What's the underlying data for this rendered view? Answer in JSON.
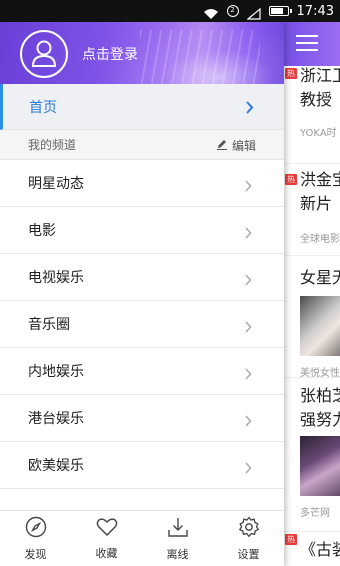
{
  "status_bar": {
    "time": "17:43",
    "sim_label": "2"
  },
  "drawer": {
    "login_label": "点击登录",
    "home_label": "首页",
    "section_title": "我的频道",
    "edit_label": "编辑",
    "channels": [
      {
        "label": "明星动态"
      },
      {
        "label": "电影"
      },
      {
        "label": "电视娱乐"
      },
      {
        "label": "音乐圈"
      },
      {
        "label": "内地娱乐"
      },
      {
        "label": "港台娱乐"
      },
      {
        "label": "欧美娱乐"
      }
    ],
    "bottom_nav": [
      {
        "label": "发现",
        "icon": "compass-icon"
      },
      {
        "label": "收藏",
        "icon": "heart-icon"
      },
      {
        "label": "离线",
        "icon": "download-icon"
      },
      {
        "label": "设置",
        "icon": "gear-icon"
      }
    ]
  },
  "feed": {
    "hot_badge": "热",
    "items": [
      {
        "title_line1": "浙江卫",
        "title_line2": "教授",
        "source": "YOKA时"
      },
      {
        "title_line1": "洪金宝",
        "title_line2": "新片",
        "source": "全球电影"
      },
      {
        "title_line1": "女星无",
        "source": "美悦女性"
      },
      {
        "title_line1": "张柏芝",
        "title_line2": "强努力",
        "source": "多芒网"
      },
      {
        "title_line1": "《古装"
      }
    ]
  },
  "colors": {
    "accent": "#2a7bd6",
    "header_purple": "#7750e6",
    "hot_red": "#e83b3b"
  }
}
